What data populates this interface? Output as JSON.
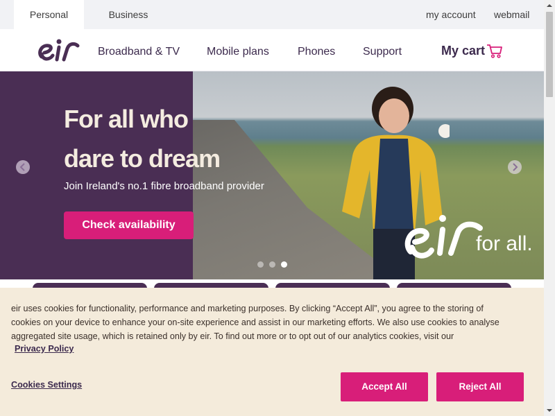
{
  "topbar": {
    "segments": [
      "Personal",
      "Business"
    ],
    "links": [
      "my account",
      "webmail"
    ]
  },
  "nav": {
    "logo": "eir",
    "items": [
      "Broadband & TV",
      "Mobile plans",
      "Phones",
      "Support"
    ],
    "cart_label": "My cart"
  },
  "hero": {
    "title_line1": "For all who",
    "title_line2": "dare to dream",
    "subtitle": "Join Ireland's no.1 fibre broadband provider",
    "cta": "Check availability",
    "tagline": "for all.",
    "slides": 3,
    "active_slide": 3
  },
  "cookie": {
    "text": "eir uses cookies for functionality, performance and marketing purposes. By clicking “Accept All”, you agree to the storing of cookies on your device to enhance your on-site experience and assist in our marketing efforts. We also use cookies to analyse aggregated site usage, which is retained only by eir. To find out more or to opt out of our analytics cookies, visit our",
    "privacy_link": "Privacy Policy",
    "settings_link": "Cookies Settings",
    "accept": "Accept All",
    "reject": "Reject All"
  },
  "colors": {
    "brand_purple": "#4a2e54",
    "brand_pink": "#d81e79",
    "cookie_bg": "#f4ebdb"
  },
  "icons": [
    "eir-logo",
    "cart-icon",
    "chevron-left-icon",
    "chevron-right-icon",
    "scroll-up-icon",
    "scroll-down-icon"
  ]
}
